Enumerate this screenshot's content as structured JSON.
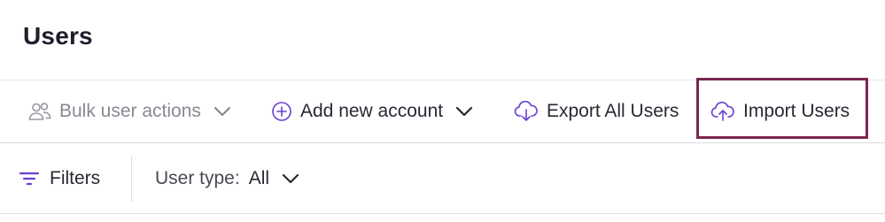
{
  "header": {
    "title": "Users"
  },
  "toolbar": {
    "bulk_actions": {
      "label": "Bulk user actions",
      "icon": "users-icon",
      "disabled": true
    },
    "add_account": {
      "label": "Add new account",
      "icon": "plus-circle-icon"
    },
    "export_users": {
      "label": "Export All Users",
      "icon": "cloud-download-icon"
    },
    "import_users": {
      "label": "Import Users",
      "icon": "cloud-upload-icon",
      "highlighted": true
    }
  },
  "filters": {
    "filters_label": "Filters",
    "filters_icon": "filter-lines-icon",
    "user_type_label": "User type:",
    "user_type_value": "All"
  },
  "colors": {
    "accent": "#6b3fd0",
    "highlight_border": "#7a2650",
    "text_primary": "#2a2833",
    "text_muted": "#8a8794"
  }
}
